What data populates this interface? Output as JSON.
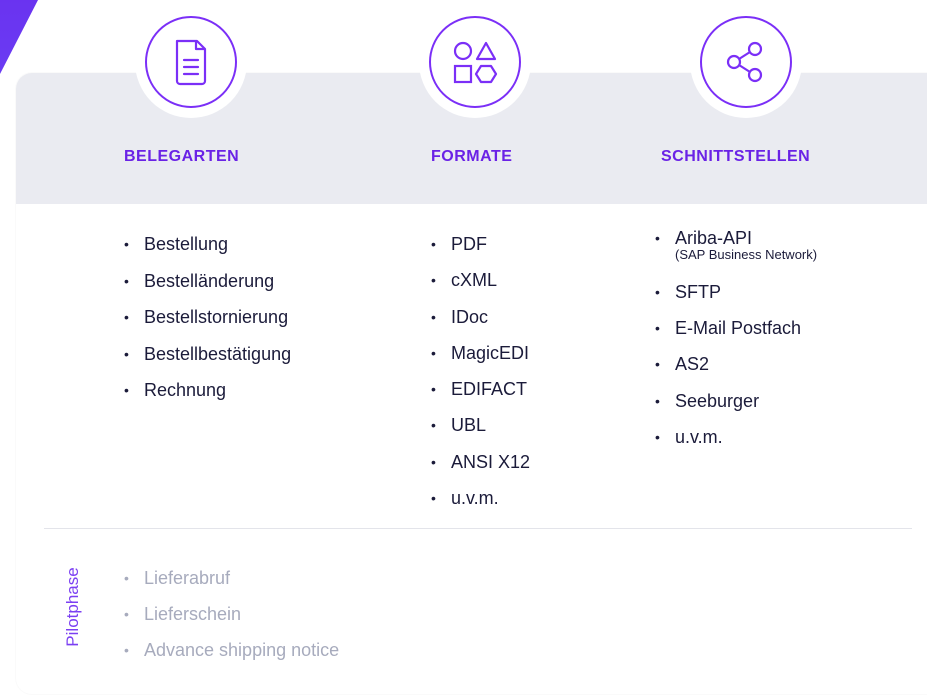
{
  "columns": [
    {
      "title": "BELEGARTEN",
      "icon": "document-icon",
      "items": [
        "Bestellung",
        "Bestelländerung",
        "Bestellstornierung",
        "Bestellbestätigung",
        "Rechnung"
      ]
    },
    {
      "title": "FORMATE",
      "icon": "shapes-icon",
      "items": [
        "PDF",
        "cXML",
        "IDoc",
        "MagicEDI",
        "EDIFACT",
        "UBL",
        "ANSI X12",
        "u.v.m."
      ]
    },
    {
      "title": "SCHNITTSTELLEN",
      "icon": "share-icon",
      "items": [
        "Ariba-API",
        "SFTP",
        "E-Mail Postfach",
        "AS2",
        "Seeburger",
        "u.v.m."
      ],
      "first_item_sub": "(SAP Business Network)"
    }
  ],
  "pilot": {
    "label": "Pilotphase",
    "items": [
      "Lieferabruf",
      "Lieferschein",
      "Advance shipping notice"
    ]
  },
  "colors": {
    "accent": "#6a22e6",
    "header_bg": "#eaebf1",
    "text": "#1b1b3a",
    "muted": "#a7abbd"
  }
}
